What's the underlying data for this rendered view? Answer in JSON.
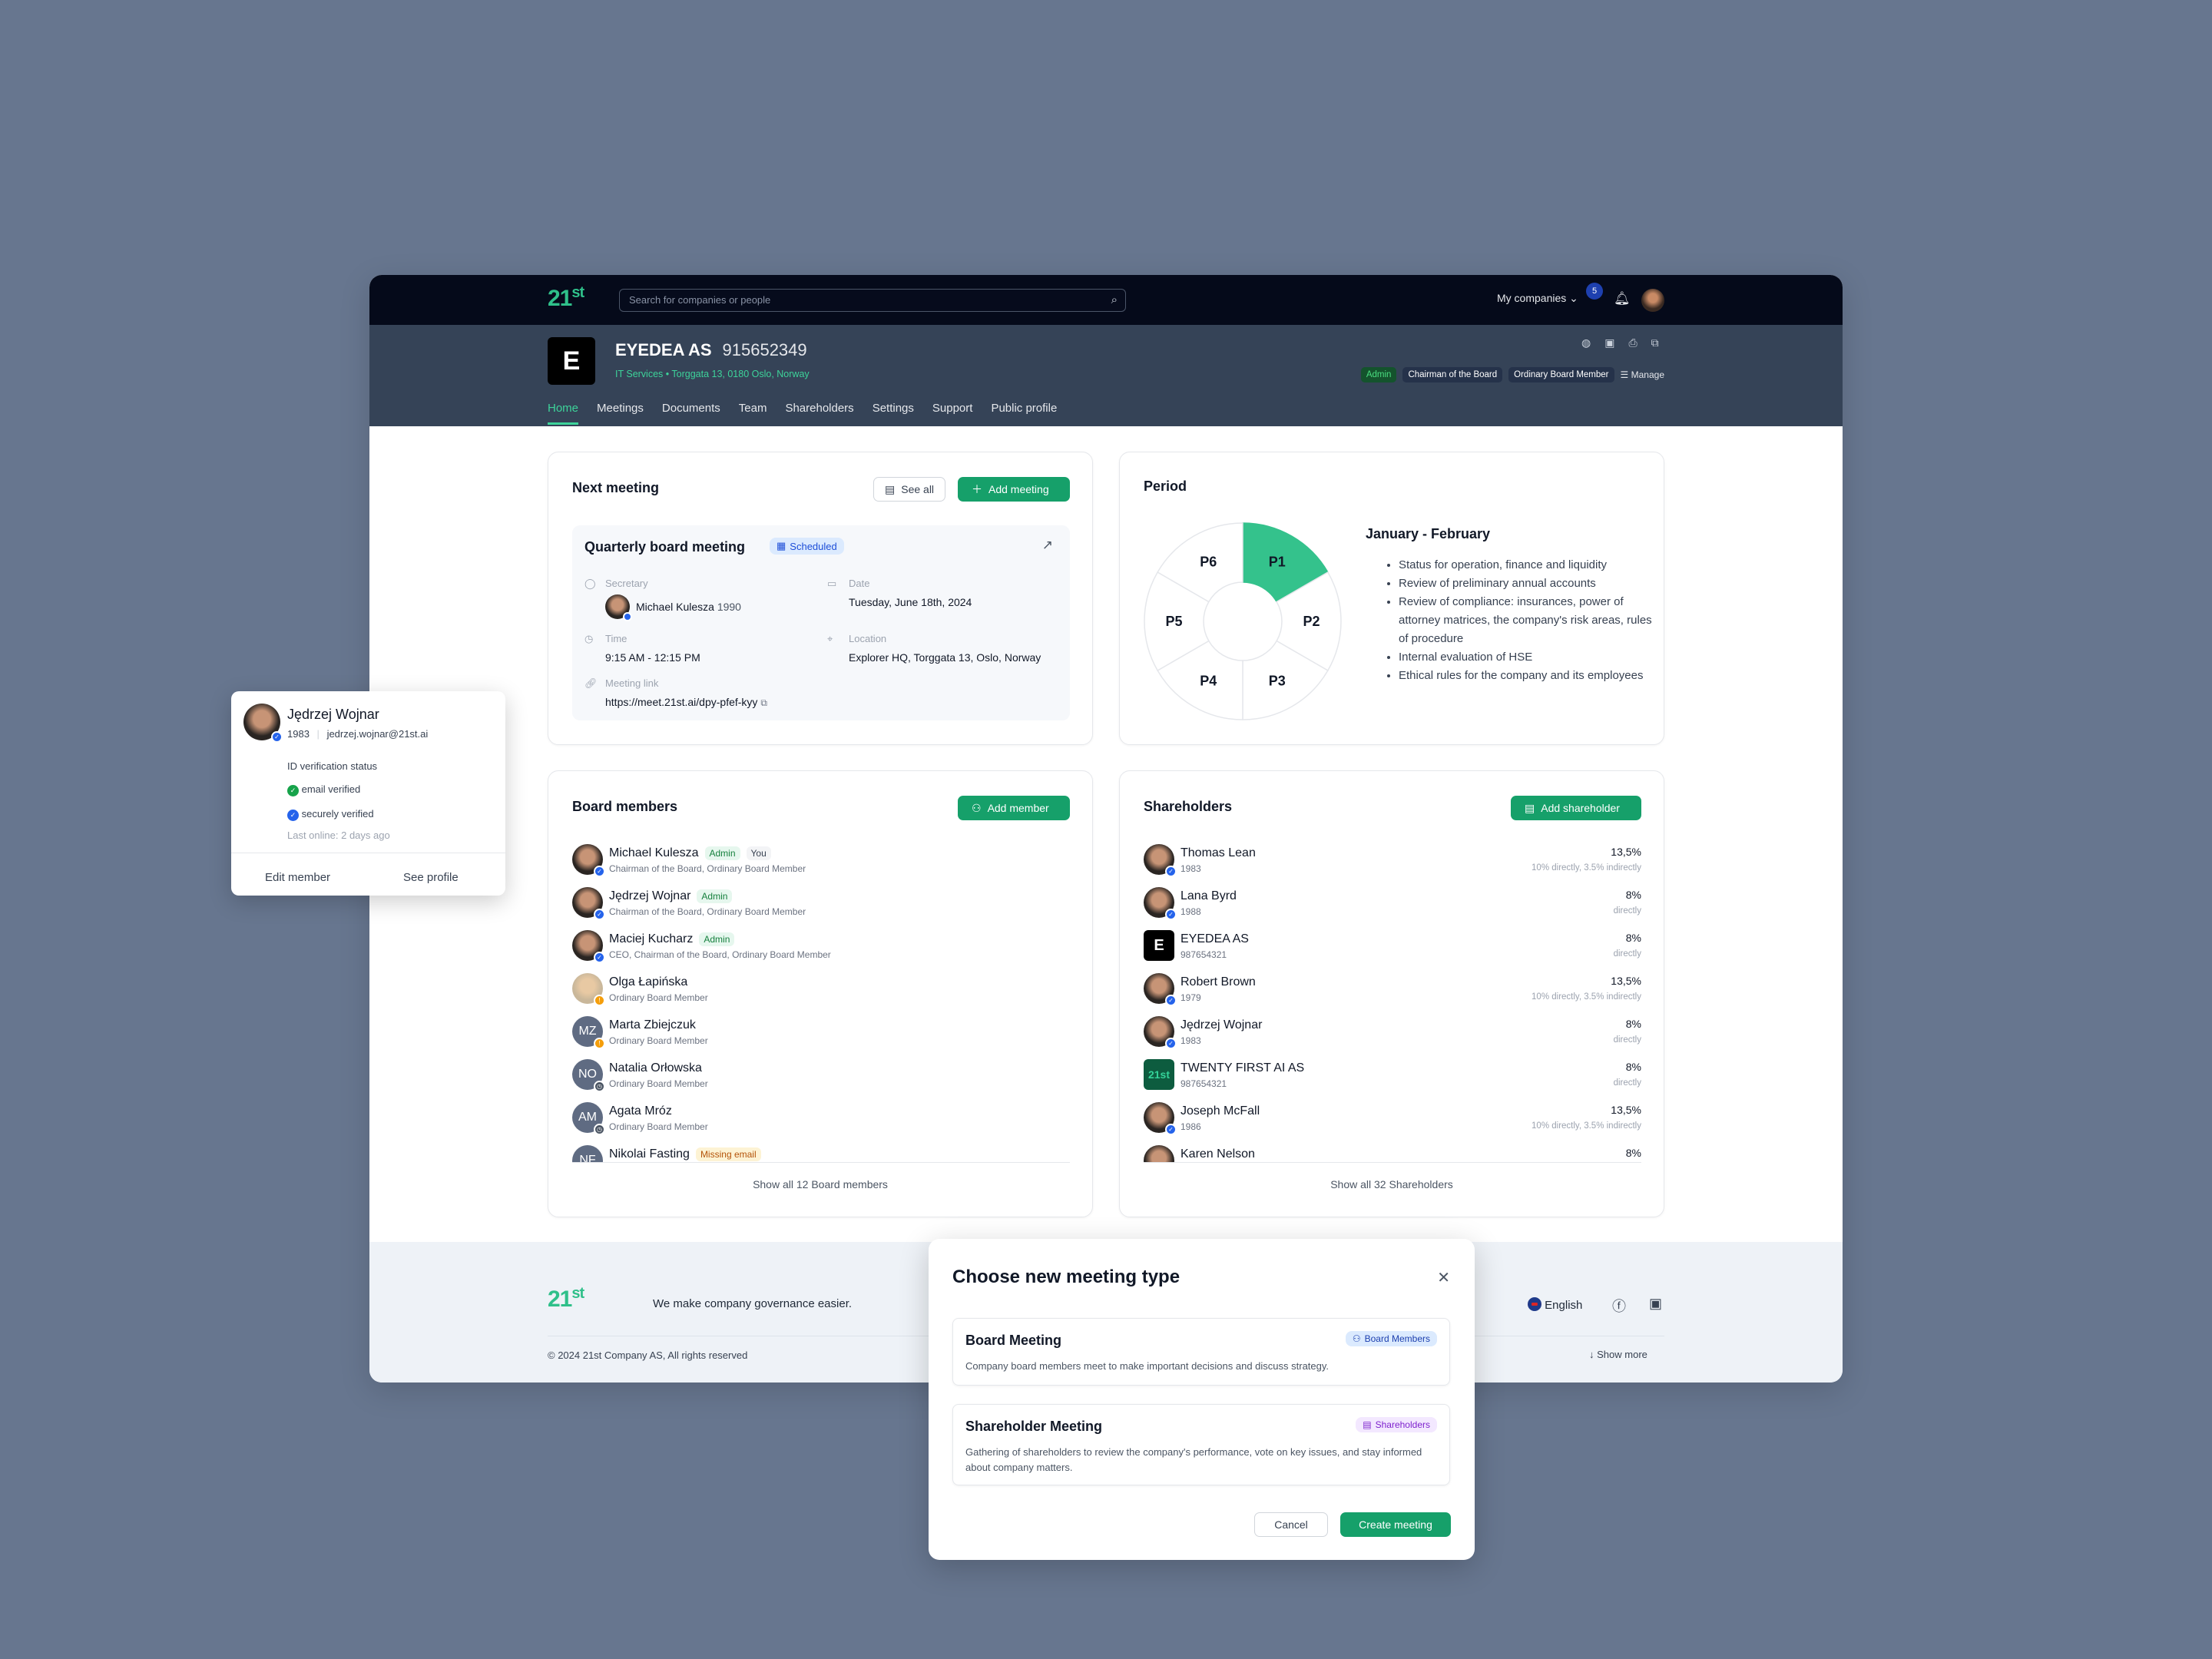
{
  "colors": {
    "accent": "#16a06a",
    "brand_green": "#2fc08a",
    "topbar": "#050a1a",
    "header": "#354357",
    "verified": "#2563eb",
    "pending": "#f59e0b"
  },
  "topbar": {
    "logo": "21st",
    "search_placeholder": "Search for companies or people",
    "search_icon": "search-icon",
    "my_companies": "My companies",
    "notifications_count": "5"
  },
  "company": {
    "logo_letter": "E",
    "name": "EYEDEA AS",
    "org_number": "915652349",
    "subtitle": "IT Services • Torggata 13, 0180 Oslo, Norway",
    "roles": [
      "Admin",
      "Chairman of the Board",
      "Ordinary Board Member"
    ],
    "manage": "Manage"
  },
  "tabs": [
    {
      "label": "Home",
      "active": true
    },
    {
      "label": "Meetings"
    },
    {
      "label": "Documents"
    },
    {
      "label": "Team"
    },
    {
      "label": "Shareholders"
    },
    {
      "label": "Settings"
    },
    {
      "label": "Support"
    },
    {
      "label": "Public profile"
    }
  ],
  "next_meeting": {
    "title": "Next meeting",
    "see_all": "See all",
    "add_meeting": "Add meeting",
    "meeting_title": "Quarterly board meeting",
    "status": "Scheduled",
    "secretary_label": "Secretary",
    "secretary_name": "Michael Kulesza",
    "secretary_year": "1990",
    "date_label": "Date",
    "date": "Tuesday, June 18th, 2024",
    "time_label": "Time",
    "time": "9:15 AM - 12:15 PM",
    "location_label": "Location",
    "location": "Explorer HQ, Torggata 13, Oslo, Norway",
    "link_label": "Meeting link",
    "link": "https://meet.21st.ai/dpy-pfef-kyy"
  },
  "period": {
    "title": "Period",
    "segments": [
      "P1",
      "P2",
      "P3",
      "P4",
      "P5",
      "P6"
    ],
    "active_segment": "P1",
    "range": "January - February",
    "items": [
      "Status for operation, finance and liquidity",
      "Review of preliminary annual accounts",
      "Review of compliance: insurances, power of attorney matrices, the company's risk areas, rules of procedure",
      "Internal evaluation of HSE",
      "Ethical rules for the company and its employees"
    ]
  },
  "board": {
    "title": "Board members",
    "add": "Add member",
    "show_all": "Show all 12 Board members",
    "members": [
      {
        "name": "Michael Kulesza",
        "roles": "Chairman of the Board, Ordinary Board Member",
        "tags": [
          "Admin",
          "You"
        ],
        "status": "verified",
        "photo": true
      },
      {
        "name": "Jędrzej Wojnar",
        "roles": "Chairman of the Board, Ordinary Board Member",
        "tags": [
          "Admin"
        ],
        "status": "verified",
        "photo": true
      },
      {
        "name": "Maciej Kucharz",
        "roles": "CEO, Chairman of the Board, Ordinary Board Member",
        "tags": [
          "Admin"
        ],
        "status": "verified",
        "photo": true
      },
      {
        "name": "Olga Łapińska",
        "roles": "Ordinary Board Member",
        "tags": [],
        "status": "pending",
        "photo": true,
        "light": true
      },
      {
        "name": "Marta Zbiejczuk",
        "roles": "Ordinary Board Member",
        "tags": [],
        "status": "pending",
        "initials": "MZ"
      },
      {
        "name": "Natalia Orłowska",
        "roles": "Ordinary Board Member",
        "tags": [],
        "status": "waiting",
        "initials": "NO"
      },
      {
        "name": "Agata Mróz",
        "roles": "Ordinary Board Member",
        "tags": [],
        "status": "waiting",
        "initials": "AM"
      },
      {
        "name": "Nikolai Fasting",
        "roles": "",
        "tags": [
          "Missing email"
        ],
        "status": "",
        "initials": "NF"
      }
    ]
  },
  "shareholders": {
    "title": "Shareholders",
    "add": "Add shareholder",
    "show_all": "Show all 32 Shareholders",
    "items": [
      {
        "name": "Thomas Lean",
        "sub": "1983",
        "pct": "13,5%",
        "detail": "10% directly, 3.5% indirectly",
        "kind": "person"
      },
      {
        "name": "Lana Byrd",
        "sub": "1988",
        "pct": "8%",
        "detail": "directly",
        "kind": "person"
      },
      {
        "name": "EYEDEA AS",
        "sub": "987654321",
        "pct": "8%",
        "detail": "directly",
        "kind": "company",
        "logo": "E"
      },
      {
        "name": "Robert Brown",
        "sub": "1979",
        "pct": "13,5%",
        "detail": "10% directly, 3.5% indirectly",
        "kind": "person"
      },
      {
        "name": "Jędrzej Wojnar",
        "sub": "1983",
        "pct": "8%",
        "detail": "directly",
        "kind": "person"
      },
      {
        "name": "TWENTY FIRST AI AS",
        "sub": "987654321",
        "pct": "8%",
        "detail": "directly",
        "kind": "company21",
        "logo": "21st"
      },
      {
        "name": "Joseph McFall",
        "sub": "1986",
        "pct": "13,5%",
        "detail": "10% directly, 3.5% indirectly",
        "kind": "person"
      },
      {
        "name": "Karen Nelson",
        "sub": "",
        "pct": "8%",
        "detail": "",
        "kind": "person"
      }
    ]
  },
  "footer": {
    "logo": "21st",
    "tagline": "We make company governance easier.",
    "language": "English",
    "copyright": "© 2024 21st Company AS, All rights reserved",
    "show_more": "Show more"
  },
  "popover": {
    "name": "Jędrzej Wojnar",
    "year": "1983",
    "email": "jedrzej.wojnar@21st.ai",
    "heading": "ID verification status",
    "checks": [
      "email verified",
      "securely verified"
    ],
    "last_online": "Last online: 2 days ago",
    "edit": "Edit member",
    "see_profile": "See profile"
  },
  "modal": {
    "title": "Choose new meeting type",
    "options": [
      {
        "title": "Board Meeting",
        "tag": "Board Members",
        "desc": "Company board members meet to make important decisions and discuss strategy."
      },
      {
        "title": "Shareholder Meeting",
        "tag": "Shareholders",
        "desc": "Gathering of shareholders to review the company's performance, vote on key issues, and stay informed about company matters."
      }
    ],
    "cancel": "Cancel",
    "create": "Create meeting"
  }
}
